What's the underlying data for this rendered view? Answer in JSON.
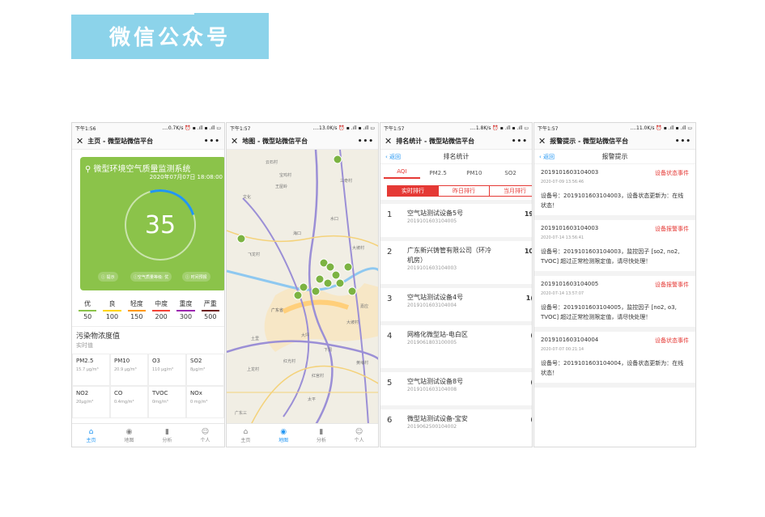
{
  "banner": {
    "title": "微信公众号"
  },
  "phones": [
    {
      "status": {
        "time": "下午1:56",
        "info": "....0.7K/s ⏰ ▪ .ıll ▪ .ıll ▭"
      },
      "nav": {
        "title": "主页 - 微型站微信平台",
        "more": "•••"
      },
      "card": {
        "title": "微型环境空气质量监测系统",
        "date": "2020年07月07日 18:08:00",
        "aqi": "35",
        "pills": [
          "提示",
          "空气质量等级: 优",
          "时间预报"
        ]
      },
      "levels": [
        {
          "label": "优",
          "value": "50",
          "color": "#8bc34a"
        },
        {
          "label": "良",
          "value": "100",
          "color": "#ffd600"
        },
        {
          "label": "轻度",
          "value": "150",
          "color": "#ff9800"
        },
        {
          "label": "中度",
          "value": "200",
          "color": "#f44336"
        },
        {
          "label": "重度",
          "value": "300",
          "color": "#9c27b0"
        },
        {
          "label": "严重",
          "value": "500",
          "color": "#6d1b1b"
        }
      ],
      "pollutant_title": "污染物浓度值",
      "pollutant_sub": "实时值",
      "pollutants": [
        {
          "name": "PM2.5",
          "value": "15.7 μg/m³"
        },
        {
          "name": "PM10",
          "value": "20.9 μg/m³"
        },
        {
          "name": "O3",
          "value": "110 μg/m³"
        },
        {
          "name": "SO2",
          "value": "8μg/m³"
        },
        {
          "name": "NO2",
          "value": "20μg/m³"
        },
        {
          "name": "CO",
          "value": "0.4mg/m³"
        },
        {
          "name": "TVOC",
          "value": "0mg/m³"
        },
        {
          "name": "NOx",
          "value": "0 mg/m³"
        }
      ]
    },
    {
      "status": {
        "time": "下午1:57",
        "info": "....13.0K/s ⏰ ▪ .ıll ▪ .ıll ▭"
      },
      "nav": {
        "title": "地图 - 微型站微信平台",
        "more": "•••"
      },
      "map_labels": [
        "云石村",
        "宝鸡村",
        "王屋岭",
        "文化",
        "三奇村",
        "海口",
        "水口",
        "大坡村",
        "飞龙村",
        "大坡村",
        "嘉应",
        "广东省",
        "土里",
        "大坪",
        "下洞",
        "红光村",
        "上龙村",
        "红宫村",
        "太平",
        "黄埔村",
        "广东三"
      ]
    },
    {
      "status": {
        "time": "下午1:57",
        "info": "....1.8K/s ⏰ ▪ .ıll ▪ .ıll ▭"
      },
      "nav": {
        "title": "排名统计 - 微型站微信平台",
        "more": "•••"
      },
      "back": "返回",
      "header": "排名统计",
      "tabs": [
        "AQI",
        "PM2.5",
        "PM10",
        "SO2"
      ],
      "segments": [
        "实时排行",
        "昨日排行",
        "当月排行"
      ],
      "rows": [
        {
          "no": "1",
          "name": "空气站测试设备5号",
          "id": "2019101603104005",
          "val": "19"
        },
        {
          "no": "2",
          "name": "广东新兴铸管有限公司（环冷机房）",
          "id": "2019101603104003",
          "val": "10"
        },
        {
          "no": "3",
          "name": "空气站测试设备4号",
          "id": "2019101603104004",
          "val": "1("
        },
        {
          "no": "4",
          "name": "网格化微型站-电白区",
          "id": "2019061803100005",
          "val": "("
        },
        {
          "no": "5",
          "name": "空气站测试设备8号",
          "id": "2019101603104008",
          "val": "("
        },
        {
          "no": "6",
          "name": "微型站测试设备-宝安",
          "id": "2019062500104002",
          "val": "("
        }
      ]
    },
    {
      "status": {
        "time": "下午1:57",
        "info": "....11.0K/s ⏰ ▪ .ıll ▪ .ıll ▭"
      },
      "nav": {
        "title": "报警提示 - 微型站微信平台",
        "more": "•••"
      },
      "back": "返回",
      "header": "报警提示",
      "alerts": [
        {
          "id": "2019101603104003",
          "tag": "设备状态事件",
          "time": "2020-07-09 13:56:46",
          "msg": "设备号：2019101603104003，设备状态更新为：在线状态！"
        },
        {
          "id": "2019101603104003",
          "tag": "设备报警事件",
          "time": "2020-07-14 13:56:41",
          "msg": "设备号：2019101603104003，监控因子 [so2, no2, TVOC] 超过正常检测限定值，请尽快处理！"
        },
        {
          "id": "2019101603104005",
          "tag": "设备报警事件",
          "time": "2020-07-14 13:57:07",
          "msg": "设备号：2019101603104005，监控因子 [no2, o3, TVOC] 超过正常检测限定值，请尽快处理！"
        },
        {
          "id": "2019101603104004",
          "tag": "设备状态事件",
          "time": "2020-07-07 00:21:14",
          "msg": "设备号：2019101603104004，设备状态更新为：在线状态！"
        }
      ]
    }
  ],
  "tabbar": [
    "主页",
    "地图",
    "分析",
    "个人"
  ]
}
